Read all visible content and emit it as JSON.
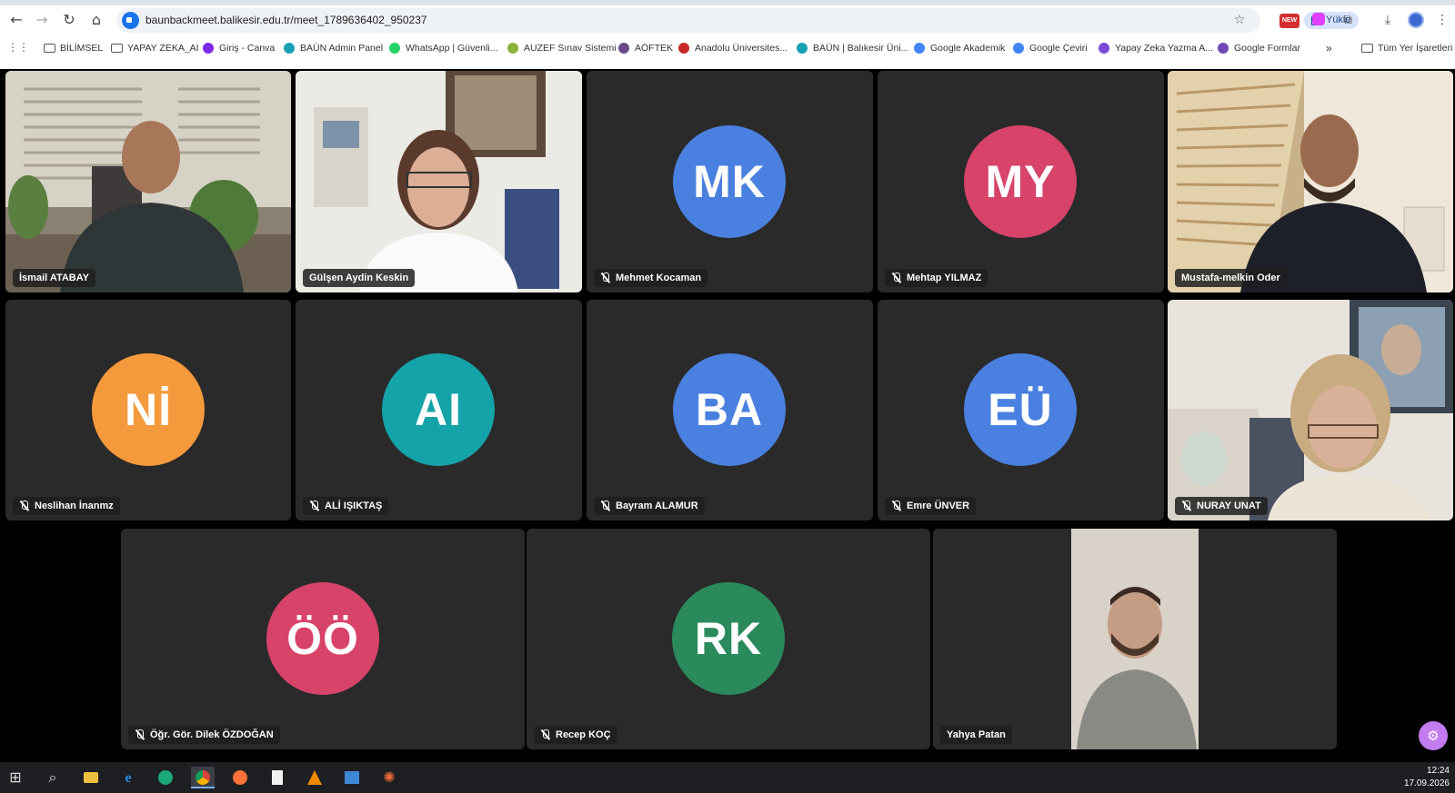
{
  "browser": {
    "url": "baunbackmeet.balikesir.edu.tr/meet_1789636402_950237",
    "upload_label": "Yükle",
    "new_badge": "NEW",
    "back_icon": "←",
    "forward_icon": "→",
    "reload_icon": "↻",
    "home_icon": "⌂",
    "star_icon": "☆",
    "extensions_icon": "⧉",
    "download_icon": "⤓",
    "menu_icon": "⋮",
    "apps_icon": "⋮⋮"
  },
  "bookmarks": {
    "items": [
      {
        "label": "BİLİMSEL",
        "icon": "folder-icon"
      },
      {
        "label": "YAPAY ZEKA_AI",
        "icon": "folder-icon"
      },
      {
        "label": "Giriş - Canva",
        "icon": "canva-icon",
        "color": "#7d2ae8"
      },
      {
        "label": "BAÜN Admin Panel",
        "icon": "baun-icon",
        "color": "#18a0b4"
      },
      {
        "label": "WhatsApp | Güvenli...",
        "icon": "whatsapp-icon",
        "color": "#25d366"
      },
      {
        "label": "AUZEF Sınav Sistemi",
        "icon": "auzef-icon",
        "color": "#8bb13a"
      },
      {
        "label": "AÖFTEK",
        "icon": "aoftek-icon",
        "color": "#6b4b8a"
      },
      {
        "label": "Anadolu Üniversites...",
        "icon": "anadolu-icon",
        "color": "#c62828"
      },
      {
        "label": "BAÜN | Balıkesir Üni...",
        "icon": "baun-icon",
        "color": "#18a0b4"
      },
      {
        "label": "Google Akademik",
        "icon": "scholar-icon",
        "color": "#4285f4"
      },
      {
        "label": "Google Çeviri",
        "icon": "translate-icon",
        "color": "#4285f4"
      },
      {
        "label": "Yapay Zeka Yazma A...",
        "icon": "ai-writer-icon",
        "color": "#7b4ad9"
      },
      {
        "label": "Google Formlar",
        "icon": "forms-icon",
        "color": "#7248b9"
      }
    ],
    "more": "»",
    "all_bookmarks": "Tüm Yer İşaretleri"
  },
  "participants": [
    {
      "name": "İsmail ATABAY",
      "video": true,
      "muted": false
    },
    {
      "name": "Gülşen Aydin Keskin",
      "video": true,
      "muted": false
    },
    {
      "name": "Mehmet Kocaman",
      "initials": "MK",
      "color": "#4a80e0",
      "muted": true
    },
    {
      "name": "Mehtap YILMAZ",
      "initials": "MY",
      "color": "#d8436a",
      "muted": true
    },
    {
      "name": "Mustafa-melkin Oder",
      "video": true,
      "muted": false,
      "active_speaker": true
    },
    {
      "name": "Neslihan İnanmz",
      "initials": "Nİ",
      "color": "#f59a3c",
      "muted": true
    },
    {
      "name": "ALİ IŞIKTAŞ",
      "initials": "AI",
      "color": "#14a3a8",
      "muted": true
    },
    {
      "name": "Bayram ALAMUR",
      "initials": "BA",
      "color": "#4a80e0",
      "muted": true
    },
    {
      "name": "Emre ÜNVER",
      "initials": "EÜ",
      "color": "#4a80e0",
      "muted": true
    },
    {
      "name": "NURAY UNAT",
      "video": true,
      "muted": true
    },
    {
      "name": "Öğr. Gör. Dilek ÖZDOĞAN",
      "initials": "ÖÖ",
      "color": "#d8436a",
      "muted": true
    },
    {
      "name": "Recep KOÇ",
      "initials": "RK",
      "color": "#2a8a5c",
      "muted": true
    },
    {
      "name": "Yahya Patan",
      "video": true,
      "muted": false
    }
  ],
  "fab_icon": "⚙",
  "taskbar": {
    "start_icon": "⊞",
    "search_icon": "⌕",
    "time": "12:24",
    "date": "17.09.2026"
  }
}
